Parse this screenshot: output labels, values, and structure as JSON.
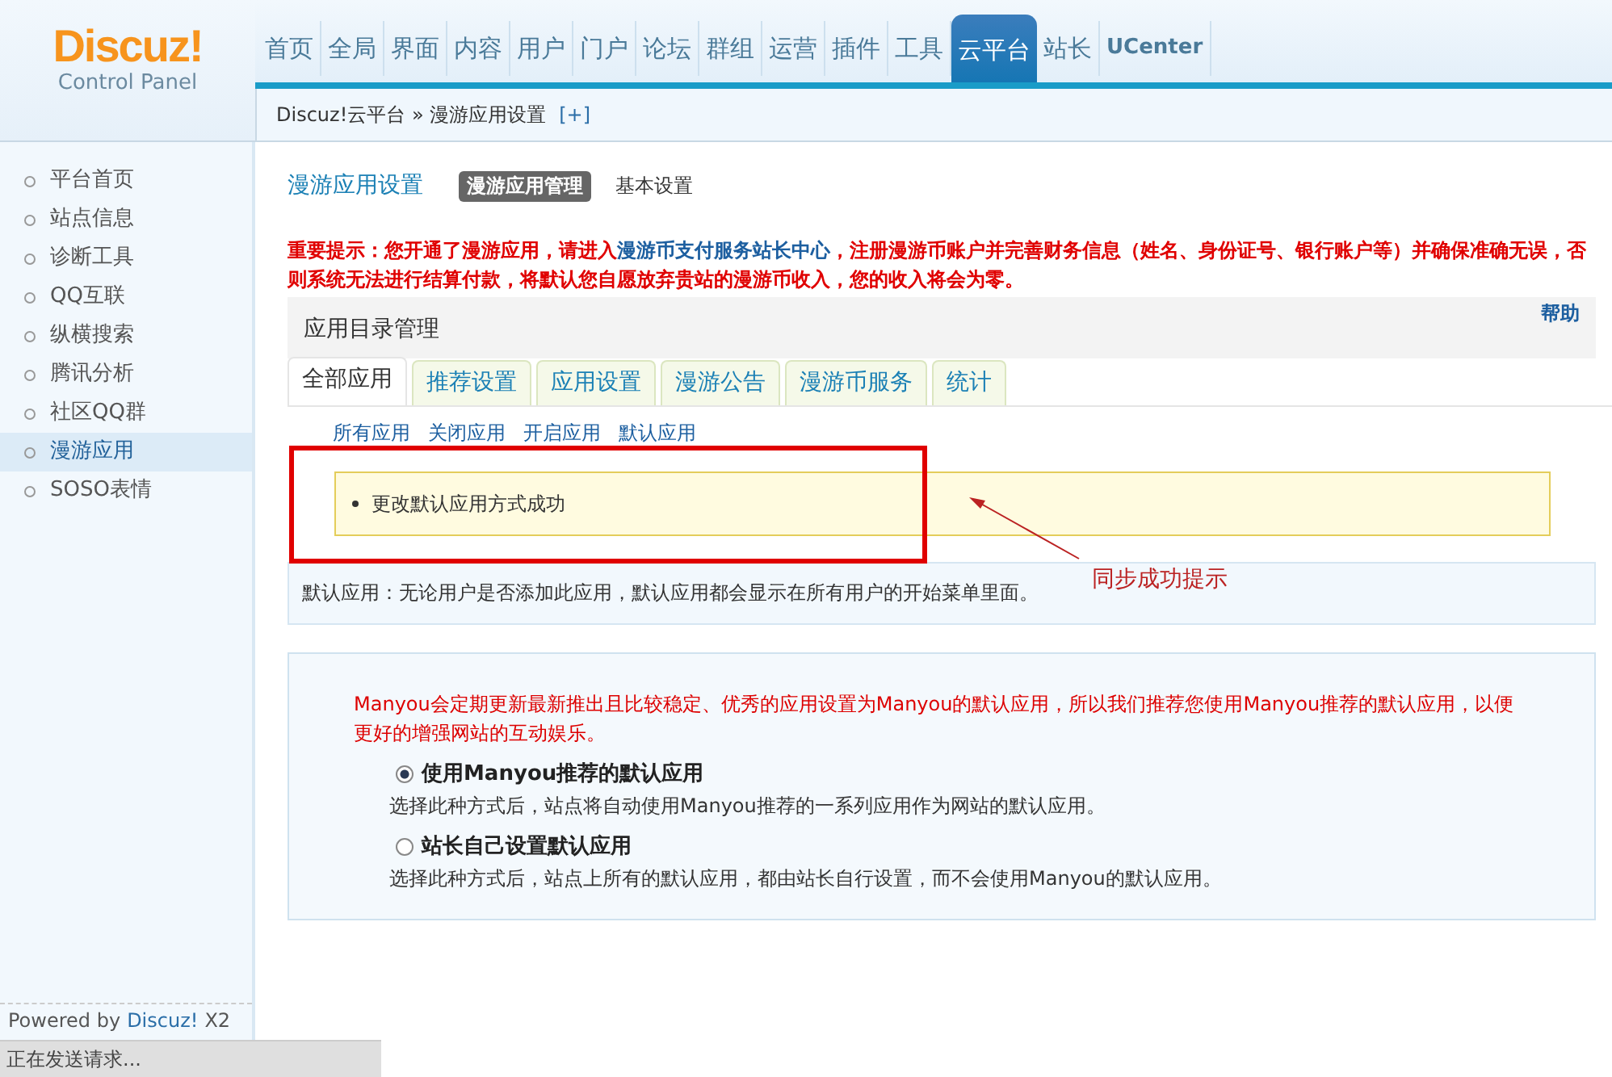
{
  "logo": {
    "name": "Discuz!",
    "subtitle": "Control Panel"
  },
  "nav": [
    {
      "label": "首页",
      "selected": false
    },
    {
      "label": "全局",
      "selected": false
    },
    {
      "label": "界面",
      "selected": false
    },
    {
      "label": "内容",
      "selected": false
    },
    {
      "label": "用户",
      "selected": false
    },
    {
      "label": "门户",
      "selected": false
    },
    {
      "label": "论坛",
      "selected": false
    },
    {
      "label": "群组",
      "selected": false
    },
    {
      "label": "运营",
      "selected": false
    },
    {
      "label": "插件",
      "selected": false
    },
    {
      "label": "工具",
      "selected": false
    },
    {
      "label": "云平台",
      "selected": true
    },
    {
      "label": "站长",
      "selected": false
    },
    {
      "label": "UCenter",
      "selected": false
    }
  ],
  "breadcrumb": {
    "path": "Discuz!云平台 » 漫游应用设置",
    "action": "[+]"
  },
  "sidebar": {
    "items": [
      {
        "label": "平台首页",
        "selected": false
      },
      {
        "label": "站点信息",
        "selected": false
      },
      {
        "label": "诊断工具",
        "selected": false
      },
      {
        "label": "QQ互联",
        "selected": false
      },
      {
        "label": "纵横搜索",
        "selected": false
      },
      {
        "label": "腾讯分析",
        "selected": false
      },
      {
        "label": "社区QQ群",
        "selected": false
      },
      {
        "label": "漫游应用",
        "selected": true
      },
      {
        "label": "SOSO表情",
        "selected": false
      }
    ],
    "footer": {
      "prefix": "Powered by",
      "brand": "Discuz!",
      "version": "X2"
    }
  },
  "page": {
    "title": "漫游应用设置",
    "tabs": [
      {
        "label": "漫游应用管理",
        "selected": true
      },
      {
        "label": "基本设置",
        "selected": false
      }
    ]
  },
  "notice": {
    "before": "重要提示：您开通了漫游应用，请进入",
    "link": "漫游币支付服务站长中心",
    "after": "，注册漫游币账户并完善财务信息（姓名、身份证号、银行账户等）并确保准确无误，否则系统无法进行结算付款，将默认您自愿放弃贵站的漫游币收入，您的收入将会为零。"
  },
  "section": {
    "title": "应用目录管理",
    "help": "帮助",
    "tabs": [
      {
        "label": "全部应用",
        "selected": true
      },
      {
        "label": "推荐设置",
        "selected": false
      },
      {
        "label": "应用设置",
        "selected": false
      },
      {
        "label": "漫游公告",
        "selected": false
      },
      {
        "label": "漫游币服务",
        "selected": false
      },
      {
        "label": "统计",
        "selected": false
      }
    ],
    "subtabs": [
      "所有应用",
      "关闭应用",
      "开启应用",
      "默认应用"
    ]
  },
  "message": "更改默认应用方式成功",
  "annotation": "同步成功提示",
  "tip": "默认应用：无论用户是否添加此应用，默认应用都会显示在所有用户的开始菜单里面。",
  "options": {
    "intro": "Manyou会定期更新最新推出且比较稳定、优秀的应用设置为Manyou的默认应用，所以我们推荐您使用Manyou推荐的默认应用，以便更好的增强网站的互动娱乐。",
    "choices": [
      {
        "label": "使用Manyou推荐的默认应用",
        "description": "选择此种方式后，站点将自动使用Manyou推荐的一系列应用作为网站的默认应用。",
        "selected": true
      },
      {
        "label": "站长自己设置默认应用",
        "description": "选择此种方式后，站点上所有的默认应用，都由站长自行设置，而不会使用Manyou的默认应用。",
        "selected": false
      }
    ]
  },
  "status_bar": "正在发送请求..."
}
